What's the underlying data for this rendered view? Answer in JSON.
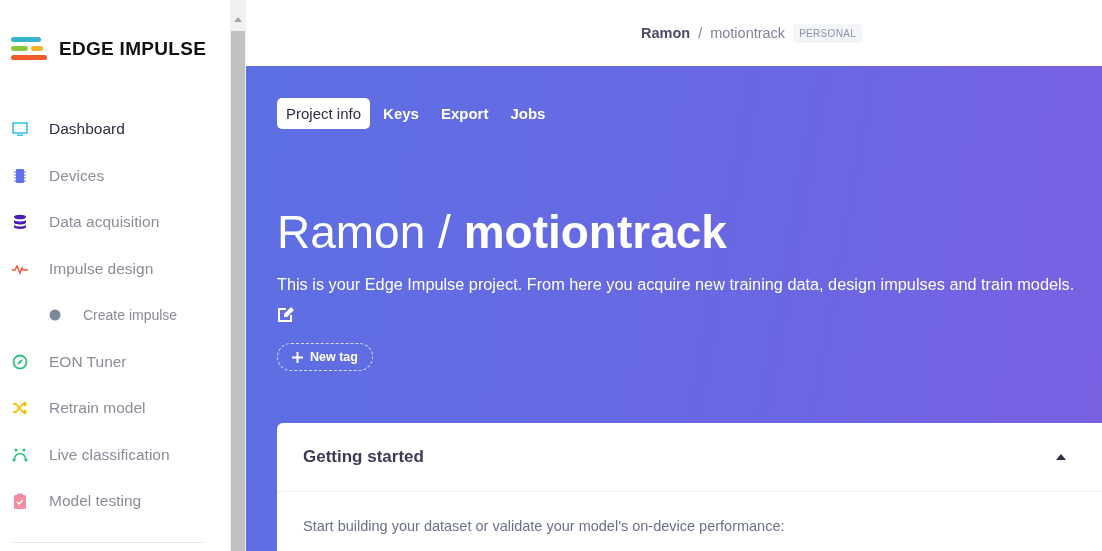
{
  "logo": {
    "text": "EDGE IMPULSE"
  },
  "nav": [
    {
      "label": "Dashboard",
      "selected": true
    },
    {
      "label": "Devices",
      "selected": false
    },
    {
      "label": "Data acquisition",
      "selected": false
    },
    {
      "label": "Impulse design",
      "selected": false,
      "children": [
        {
          "label": "Create impulse",
          "selected": false
        }
      ]
    },
    {
      "label": "EON Tuner",
      "selected": false
    },
    {
      "label": "Retrain model",
      "selected": false
    },
    {
      "label": "Live classification",
      "selected": false
    },
    {
      "label": "Model testing",
      "selected": false
    }
  ],
  "breadcrumb": {
    "owner": "Ramon",
    "separator": "/",
    "project": "motiontrack",
    "badge": "PERSONAL"
  },
  "tabs": [
    {
      "label": "Project info",
      "selected": true
    },
    {
      "label": "Keys",
      "selected": false
    },
    {
      "label": "Export",
      "selected": false
    },
    {
      "label": "Jobs",
      "selected": false
    }
  ],
  "hero": {
    "title": "Ramon / **motiontrack**",
    "description": "This is your Edge Impulse project. From here you acquire new training data, design impulses and train models.",
    "new_tag": "New tag"
  },
  "card": {
    "title": "Getting started",
    "expanded": true,
    "text": "Start building your dataset or validate your model's on-device performance:"
  }
}
